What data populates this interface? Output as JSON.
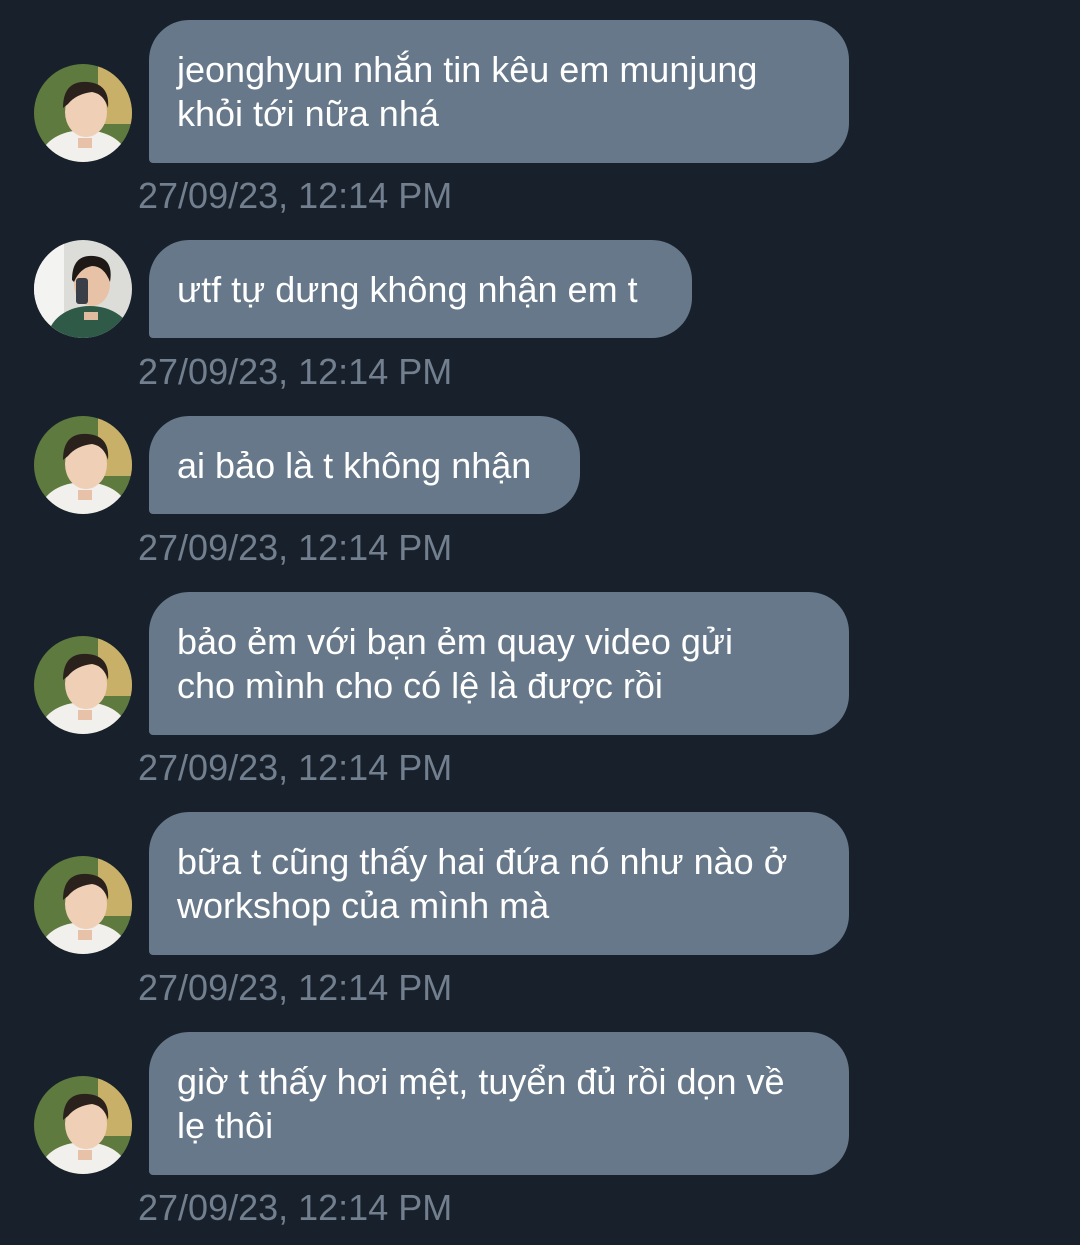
{
  "messages": [
    {
      "sender": "avatar-a",
      "text": "jeonghyun nhắn tin kêu em munjung\nkhỏi tới nữa nhá",
      "time": "27/09/23, 12:14 PM"
    },
    {
      "sender": "avatar-b",
      "text": "ưtf tự dưng không nhận em t",
      "time": "27/09/23, 12:14 PM"
    },
    {
      "sender": "avatar-a",
      "text": "ai bảo là t không nhận",
      "time": "27/09/23, 12:14 PM"
    },
    {
      "sender": "avatar-a",
      "text": "bảo ẻm với bạn ẻm quay video gửi\ncho mình cho có lệ là được rồi",
      "time": "27/09/23, 12:14 PM"
    },
    {
      "sender": "avatar-a",
      "text": "bữa t cũng thấy hai đứa nó như nào ở\nworkshop của mình mà",
      "time": "27/09/23, 12:14 PM"
    },
    {
      "sender": "avatar-a",
      "text": "giờ t thấy hơi mệt, tuyển đủ rồi dọn về\nlẹ thôi",
      "time": "27/09/23, 12:14 PM"
    }
  ],
  "colors": {
    "background": "#18202b",
    "bubble": "#66788a",
    "bubble_text": "#ffffff",
    "timestamp": "#727f8e"
  }
}
